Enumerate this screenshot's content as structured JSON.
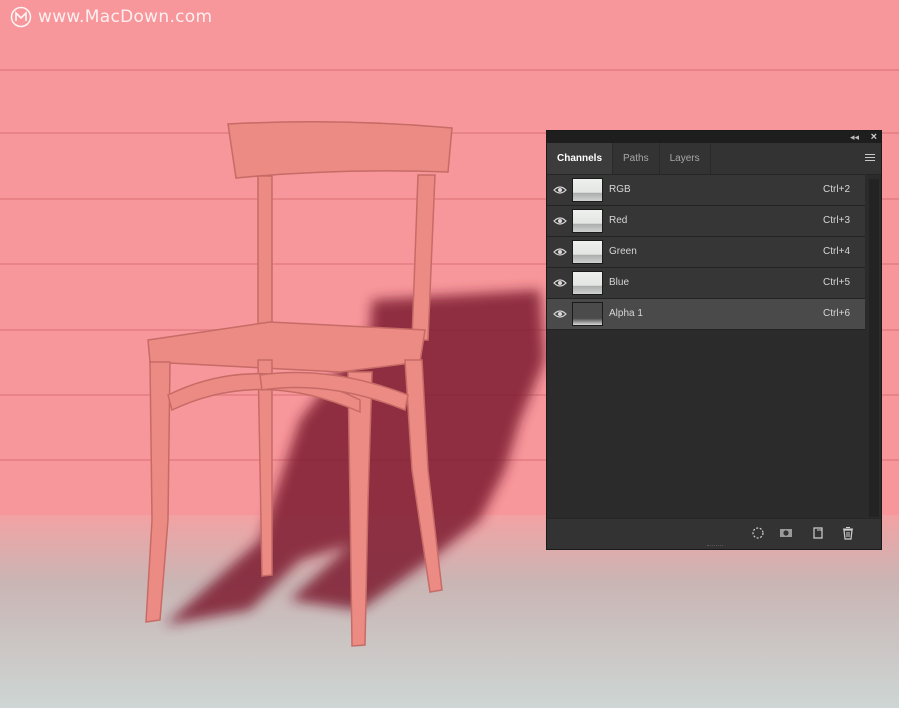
{
  "watermark": {
    "text": "www.MacDown.com"
  },
  "panel": {
    "tabs": [
      {
        "label": "Channels",
        "active": true
      },
      {
        "label": "Paths",
        "active": false
      },
      {
        "label": "Layers",
        "active": false
      }
    ],
    "channels": [
      {
        "name": "RGB",
        "shortcut": "Ctrl+2",
        "visible": true,
        "selected": false
      },
      {
        "name": "Red",
        "shortcut": "Ctrl+3",
        "visible": true,
        "selected": false
      },
      {
        "name": "Green",
        "shortcut": "Ctrl+4",
        "visible": true,
        "selected": false
      },
      {
        "name": "Blue",
        "shortcut": "Ctrl+5",
        "visible": true,
        "selected": false
      },
      {
        "name": "Alpha 1",
        "shortcut": "Ctrl+6",
        "visible": true,
        "selected": true
      }
    ],
    "bottom_icons": [
      "load-selection-icon",
      "save-selection-icon",
      "new-channel-icon",
      "trash-icon"
    ],
    "titlebar_icons": [
      "collapse-icon",
      "close-icon"
    ]
  },
  "colors": {
    "mask_overlay": "#f7979b",
    "panel_bg": "#2b2b2b",
    "selected_row": "#4a4a4a"
  }
}
